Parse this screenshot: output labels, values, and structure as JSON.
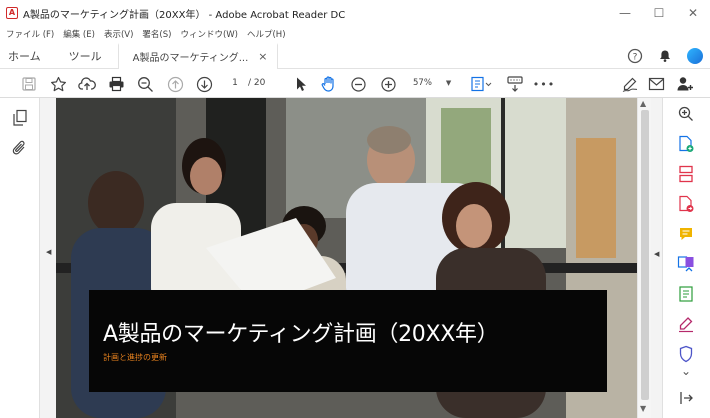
{
  "window": {
    "title": "A製品のマーケティング計画（20XX年） - Adobe Acrobat Reader DC",
    "app_icon": "acrobat-icon",
    "controls": {
      "minimize": "—",
      "maximize": "☐",
      "close": "✕"
    }
  },
  "menu": {
    "items": [
      "ファイル (F)",
      "編集 (E)",
      "表示(V)",
      "署名(S)",
      "ウィンドウ(W)",
      "ヘルプ(H)"
    ]
  },
  "tabs": {
    "home": "ホーム",
    "tools": "ツール",
    "document": "A製品のマーケティング...",
    "close": "×"
  },
  "tab_right_icons": [
    "help-icon",
    "notification-bell-icon",
    "account-avatar-icon"
  ],
  "toolbar": {
    "icons": [
      "save-icon",
      "bookmark-star-icon",
      "upload-cloud-icon",
      "print-icon",
      "zoom-out-magnifier-icon",
      "page-up-icon",
      "page-down-icon",
      "select-cursor-icon",
      "hand-tool-icon",
      "zoom-out-icon",
      "zoom-in-icon",
      "page-fit-icon",
      "keyboard-scroll-icon",
      "more-icon",
      "sign-icon",
      "email-icon",
      "share-user-icon"
    ],
    "page_current": "1",
    "page_total": "/ 20",
    "zoom": "57%",
    "more": "•••"
  },
  "left_rail": {
    "icons": [
      "page-thumbnails-icon",
      "attachment-paperclip-icon"
    ],
    "collapse": "◀"
  },
  "document": {
    "title": "A製品のマーケティング計画（20XX年）",
    "subtitle": "計画と進捗の更新",
    "scroll_up": "▲",
    "scroll_down": "▼"
  },
  "right_rail": {
    "collapse": "◀",
    "icons": [
      "zoom-search-icon",
      "create-pdf-icon",
      "organize-pages-icon",
      "export-pdf-icon",
      "comment-icon",
      "combine-files-icon",
      "edit-pdf-icon",
      "fill-sign-icon",
      "protect-shield-icon",
      "expand-panel-icon"
    ],
    "more_chevron": "⌄"
  },
  "colors": {
    "accent_blue": "#1473e6",
    "acrobat_red": "#d12b2b",
    "banner_bg": "#060606",
    "subtitle_orange": "#e8821e",
    "avatar_gradient": [
      "#2fb6ff",
      "#1a6fd8"
    ]
  }
}
